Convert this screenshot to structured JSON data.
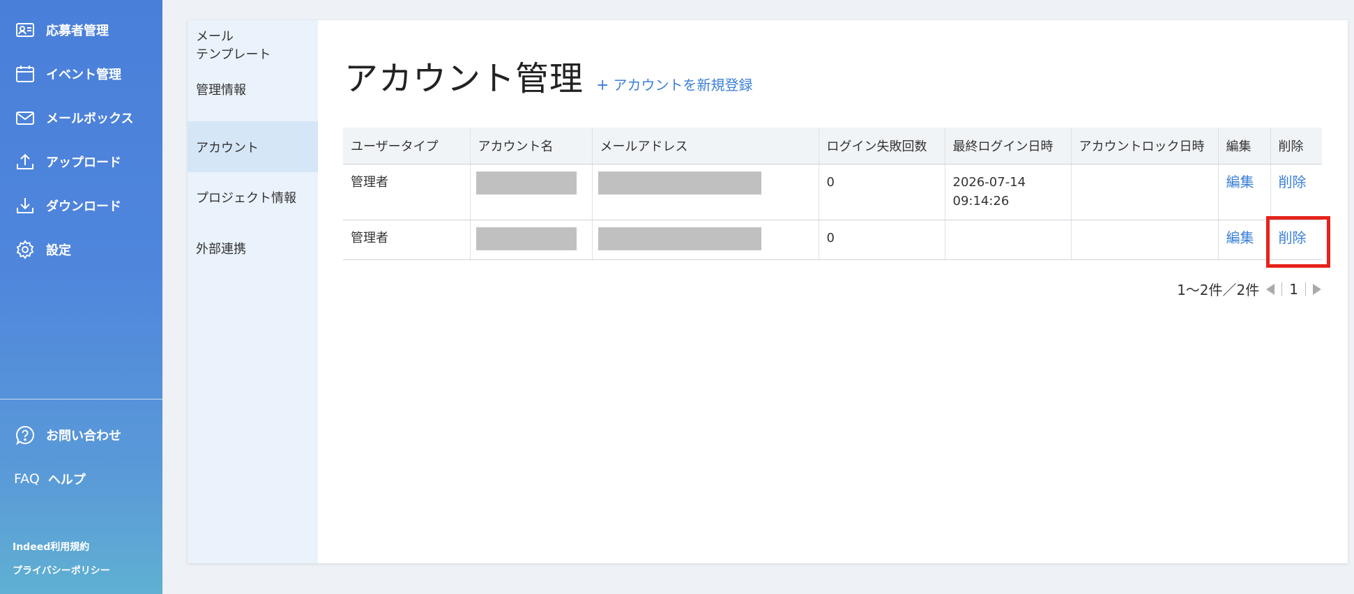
{
  "sidebar": {
    "items": [
      {
        "label": "応募者管理",
        "icon": "applicant-card-icon"
      },
      {
        "label": "イベント管理",
        "icon": "calendar-icon"
      },
      {
        "label": "メールボックス",
        "icon": "mail-icon"
      },
      {
        "label": "アップロード",
        "icon": "upload-icon"
      },
      {
        "label": "ダウンロード",
        "icon": "download-icon"
      },
      {
        "label": "設定",
        "icon": "gear-icon"
      }
    ],
    "contact": {
      "label": "お問い合わせ",
      "icon": "question-icon"
    },
    "help": {
      "prefix": "FAQ",
      "label": "ヘルプ"
    },
    "footer": [
      "Indeed利用規約",
      "プライバシーポリシー"
    ]
  },
  "subnav": {
    "items": [
      "メール\nテンプレート",
      "管理情報",
      "アカウント",
      "プロジェクト情報",
      "外部連携"
    ],
    "active_index": 2
  },
  "page": {
    "title": "アカウント管理",
    "new_account_plus": "+",
    "new_account_label": "アカウントを新規登録"
  },
  "table": {
    "headers": [
      "ユーザータイプ",
      "アカウント名",
      "メールアドレス",
      "ログイン失敗回数",
      "最終ログイン日時",
      "アカウントロック日時",
      "編集",
      "削除"
    ],
    "rows": [
      {
        "user_type": "管理者",
        "login_failures": "0",
        "last_login_date": "2026-07-14",
        "last_login_time": "09:14:26",
        "lock_date": "",
        "edit": "編集",
        "delete": "削除"
      },
      {
        "user_type": "管理者",
        "login_failures": "0",
        "last_login_date": "",
        "last_login_time": "",
        "lock_date": "",
        "edit": "編集",
        "delete": "削除"
      }
    ]
  },
  "pagination": {
    "summary": "1〜2件／2件",
    "current_page": "1"
  },
  "colors": {
    "sidebar_top": "#4a7fd9",
    "sidebar_bottom": "#5fb0d2",
    "link": "#3a7fd6",
    "highlight": "#e5231b"
  }
}
